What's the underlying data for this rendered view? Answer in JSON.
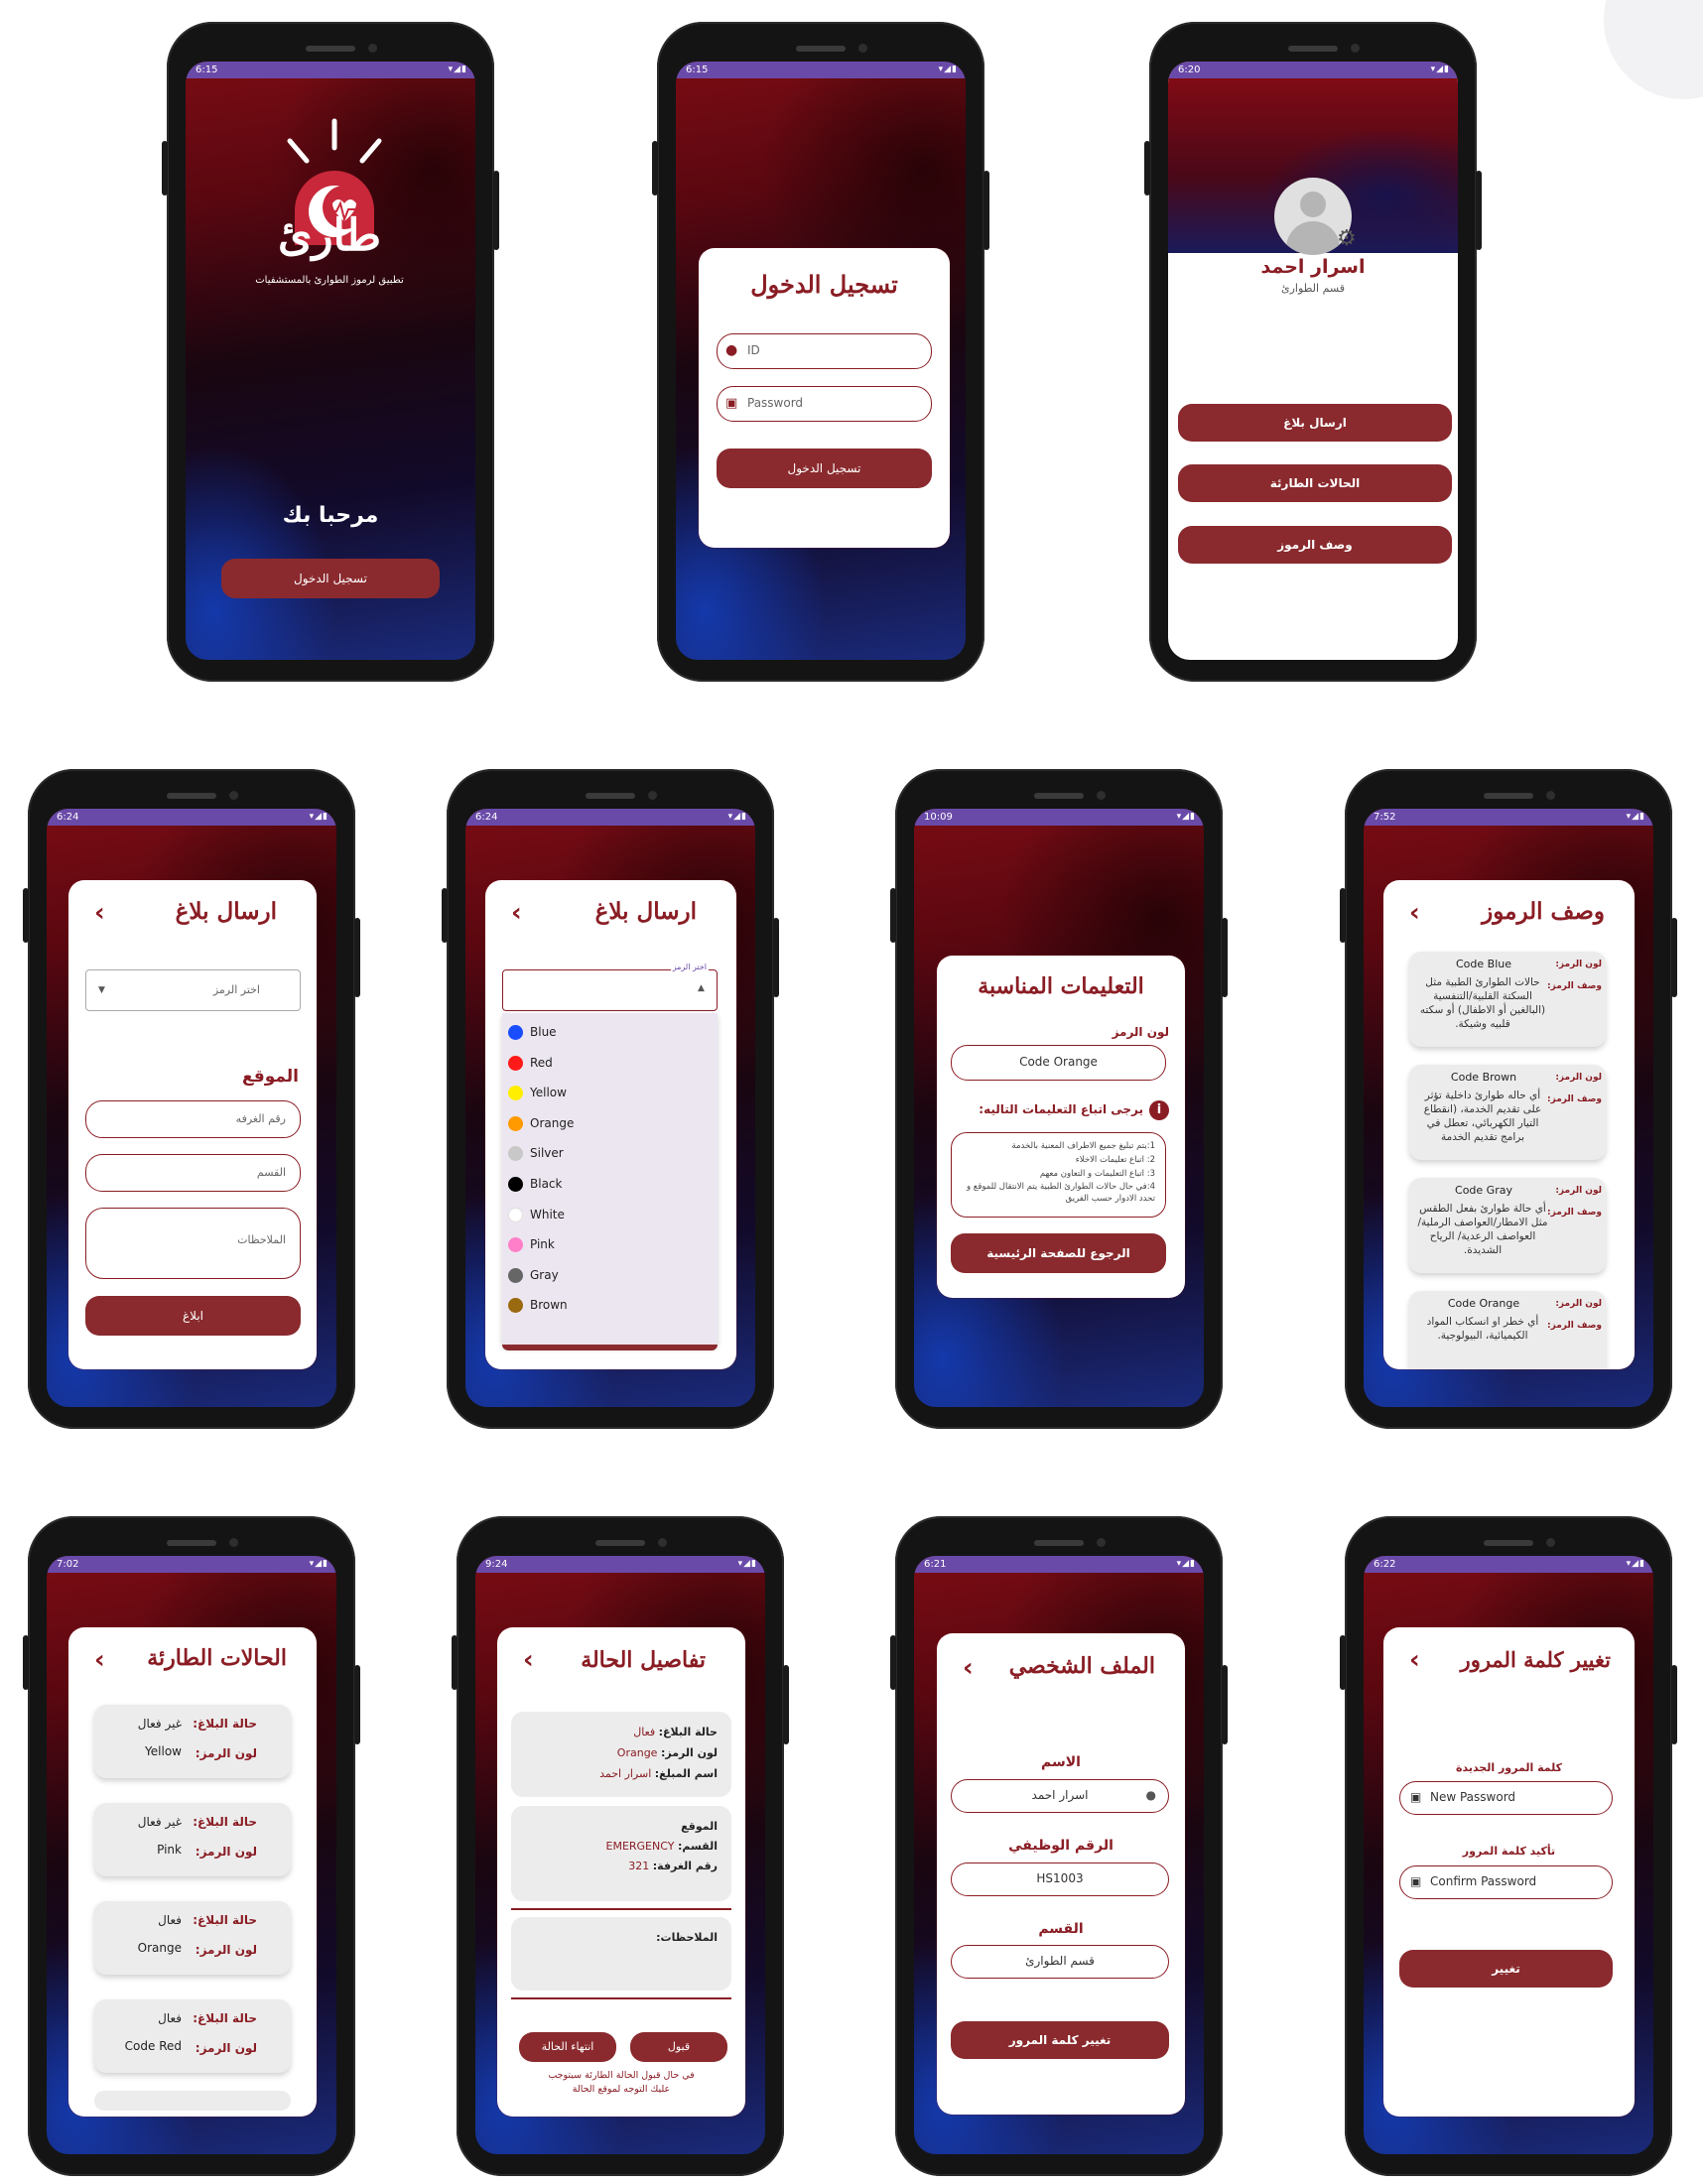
{
  "statusbar": {
    "times": [
      "6:15",
      "6:15",
      "6:20",
      "6:24",
      "6:24",
      "10:09",
      "7:52",
      "7:02",
      "9:24",
      "6:21",
      "6:22"
    ]
  },
  "splash": {
    "logo_text": "طارئ",
    "logo_subtitle": "تطبيق لرموز الطوارئ بالمستشفيات",
    "welcome": "مرحبا بك",
    "login_button": "تسجيل الدخول"
  },
  "login": {
    "title": "تسجيل الدخول",
    "id_placeholder": "ID",
    "password_placeholder": "Password",
    "submit": "تسجيل الدخول"
  },
  "home": {
    "name": "اسرار احمد",
    "department": "قسم الطوارئ",
    "buttons": [
      "ارسال بلاغ",
      "الحالات الطارئة",
      "وصف الرموز"
    ]
  },
  "report": {
    "title": "ارسال بلاغ",
    "select_placeholder": "اختر الرمز",
    "location_label": "الموقع",
    "room_placeholder": "رقم الغرفه",
    "department_placeholder": "القسم",
    "notes_placeholder": "الملاحظات",
    "submit": "ابلاغ"
  },
  "report_dropdown": {
    "title": "ارسال بلاغ",
    "floating_label": "اختر الرمز",
    "options": [
      {
        "label": "Blue",
        "color": "#1a4dff"
      },
      {
        "label": "Red",
        "color": "#ff1a1a"
      },
      {
        "label": "Yellow",
        "color": "#ffee00"
      },
      {
        "label": "Orange",
        "color": "#ff9a00"
      },
      {
        "label": "Silver",
        "color": "#c8c8c8"
      },
      {
        "label": "Black",
        "color": "#000000"
      },
      {
        "label": "White",
        "color": "#ffffff"
      },
      {
        "label": "Pink",
        "color": "#ff80c8"
      },
      {
        "label": "Gray",
        "color": "#666666"
      },
      {
        "label": "Brown",
        "color": "#9a6a10"
      }
    ]
  },
  "instructions": {
    "title": "التعليمات المناسبة",
    "code_label": "لون الرمز",
    "code_value": "Code Orange",
    "follow_label": "يرجى اتباع التعليمات التاليه:",
    "steps": [
      "1:يتم تبليغ جميع الاطراف المعنية بالخدمة",
      "2: اتباع تعليمات الاخلاء",
      "3: اتباع التعليمات و التعاون معهم",
      "4:في حال حالات الطوارئ الطبية يتم الانتقال للموقع و تحدد الادوار حسب الفريق"
    ],
    "back_button": "الرجوع للصفحة الرئيسية"
  },
  "codes": {
    "title": "وصف الرموز",
    "color_label": "لون الرمز:",
    "desc_label": "وصف الرمز:",
    "items": [
      {
        "name": "Code Blue",
        "desc": "حالات الطوارئ الطبية مثل السكتة القلبية/التنفسية (البالغين أو الاطفال) أو سكته قلبيه وشيكة."
      },
      {
        "name": "Code Brown",
        "desc": "أي حاله طوارئ داخلية تؤثر على تقديم الخدمة، (انقطاع التيار الكهربائي، تعطل في برامج تقديم الخدمة"
      },
      {
        "name": "Code Gray",
        "desc": "أي حالة طوارئ بفعل الطقس مثل الامطار/العواصف الرملية/ العواصف الرعدية/ الرياح الشديدة."
      },
      {
        "name": "Code Orange",
        "desc": "أي خطر او انسكاب المواد الكيميائية، البيولوجية."
      }
    ]
  },
  "cases": {
    "title": "الحالات الطارئة",
    "status_label": "حالة البلاغ:",
    "color_label": "لون الرمز:",
    "items": [
      {
        "status": "غير فعال",
        "color": "Yellow"
      },
      {
        "status": "غير فعال",
        "color": "Pink"
      },
      {
        "status": "فعال",
        "color": "Orange"
      },
      {
        "status": "فعال",
        "color": "Code Red"
      }
    ]
  },
  "case_details": {
    "title": "تفاصيل الحالة",
    "status_label": "حالة البلاغ:",
    "status_value": "فعال",
    "color_label": "لون الرمز:",
    "color_value": "Orange",
    "reporter_label": "اسم المبلغ:",
    "reporter_value": "اسرار احمد",
    "location_label": "الموقع",
    "department_label": "القسم:",
    "department_value": "EMERGENCY",
    "room_label": "رقم الغرفة:",
    "room_value": "321",
    "notes_label": "الملاحظات:",
    "end_button": "انتهاء الحالة",
    "accept_button": "قبول",
    "footnote_line1": "في حال قبول الحالة الطارئة سيتوجب",
    "footnote_line2": "عليك التوجه لموقع الحالة"
  },
  "profile": {
    "title": "الملف الشخصي",
    "name_label": "الاسم",
    "name_value": "اسرار احمد",
    "job_label": "الرقم الوظيفي",
    "job_value": "HS1003",
    "department_label": "القسم",
    "department_value": "قسم الطوارئ",
    "change_password_button": "تغيير كلمة المرور"
  },
  "change_password": {
    "title": "تغيير كلمة المرور",
    "new_label": "كلمة المرور الجديدة",
    "new_placeholder": "New Password",
    "confirm_label": "تأكيد كلمة المرور",
    "confirm_placeholder": "Confirm Password",
    "submit": "تغيير"
  },
  "colors": {
    "accent": "#8a2a2e",
    "status_bar": "#6a4aa8"
  }
}
